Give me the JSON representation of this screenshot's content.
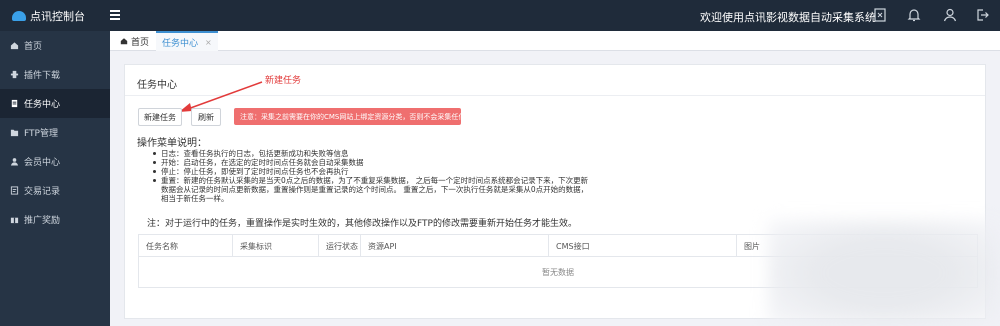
{
  "topbar": {
    "brand": "点讯控制台",
    "welcome": "欢迎使用点讯影视数据自动采集系统",
    "icons": [
      "fullscreen-icon",
      "bell-icon",
      "user-icon",
      "logout-icon"
    ]
  },
  "sidebar": {
    "items": [
      {
        "label": "首页",
        "icon": "home-icon",
        "active": false
      },
      {
        "label": "插件下载",
        "icon": "plugin-icon",
        "active": false
      },
      {
        "label": "任务中心",
        "icon": "task-icon",
        "active": true
      },
      {
        "label": "FTP管理",
        "icon": "ftp-icon",
        "active": false
      },
      {
        "label": "会员中心",
        "icon": "member-icon",
        "active": false
      },
      {
        "label": "交易记录",
        "icon": "transaction-icon",
        "active": false
      },
      {
        "label": "推广奖励",
        "icon": "reward-icon",
        "active": false
      }
    ]
  },
  "tabs": {
    "home": "首页",
    "task": "任务中心",
    "close": "×"
  },
  "card": {
    "title": "任务中心",
    "annotation": "新建任务",
    "new_button": "新建任务",
    "refresh_button": "刷新",
    "notice": "注意：采集之前需要在你的CMS网站上绑定资源分类，否则不会采集任何数据",
    "help_title": "操作菜单说明：",
    "help_items": [
      "日志：查看任务执行的日志，包括更新成功和失败等信息",
      "开始：启动任务，在选定的定时时间点任务就会自动采集数据",
      "停止：停止任务，即使到了定时时间点任务也不会再执行",
      "重置：新建的任务默认采集的是当天0点之后的数据，为了不重复采集数据， 之后每一个定时时间点系统都会记录下来，下次更新数据会从记录的时间点更新数据，重置操作则是重置记录的这个时间点。 重置之后，下一次执行任务就是采集从0点开始的数据，相当于新任务一样。"
    ],
    "note": "注：对于运行中的任务，重置操作是实时生效的，其他修改操作以及FTP的修改需要重新开始任务才能生效。"
  },
  "table": {
    "columns": [
      "任务名称",
      "采集标识",
      "运行状态",
      "资源API",
      "CMS接口",
      "图片"
    ],
    "empty_text": "暂无数据"
  },
  "colors": {
    "topbar": "#1f2b3a",
    "sidebar": "#263445",
    "accent": "#3d8fd1",
    "notice": "#ef6f6f"
  }
}
